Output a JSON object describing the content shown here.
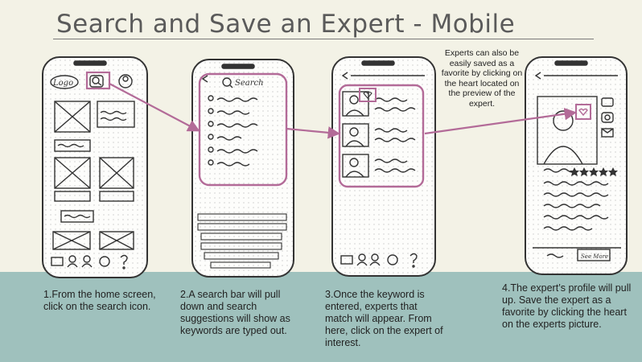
{
  "title": "Search and Save an Expert -  Mobile",
  "note": "Experts can also be easily saved as a favorite by clicking on the heart located on the preview of the expert.",
  "steps": [
    {
      "text": "1.From the home screen, click on the search icon."
    },
    {
      "text": "2.A search bar will pull down and search suggestions will show as keywords are typed out."
    },
    {
      "text": "3.Once the keyword is entered, experts that match will appear. From here, click on the expert of interest."
    },
    {
      "text": "4.The expert’s profile will pull up. Save the expert as a favorite by clicking the heart on the experts picture."
    }
  ],
  "sketch": {
    "logo": "Logo",
    "search": "Search",
    "see_more": "See More"
  },
  "colors": {
    "background": "#f3f2e6",
    "band": "#9fc1bd",
    "highlight": "#b36b98"
  }
}
